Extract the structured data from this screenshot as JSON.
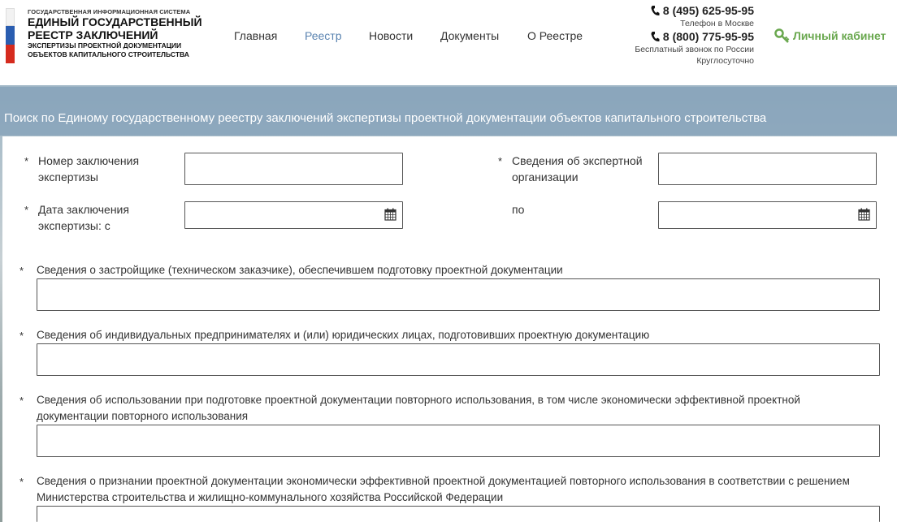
{
  "logo": {
    "top_small": "ГОСУДАРСТВЕННАЯ ИНФОРМАЦИОННАЯ СИСТЕМА",
    "line1": "ЕДИНЫЙ ГОСУДАРСТВЕННЫЙ",
    "line2": "РЕЕСТР ЗАКЛЮЧЕНИЙ",
    "line3": "ЭКСПЕРТИЗЫ ПРОЕКТНОЙ ДОКУМЕНТАЦИИ",
    "line4": "ОБЪЕКТОВ КАПИТАЛЬНОГО СТРОИТЕЛЬСТВА"
  },
  "nav": {
    "items": [
      {
        "label": "Главная"
      },
      {
        "label": "Реестр"
      },
      {
        "label": "Новости"
      },
      {
        "label": "Документы"
      },
      {
        "label": "О Реестре"
      }
    ]
  },
  "contacts": {
    "phone_moscow": "8 (495) 625-95-95",
    "note_moscow": "Телефон в Москве",
    "phone_russia": "8 (800) 775-95-95",
    "note_russia": "Бесплатный звонок по России",
    "note_hours": "Круглосуточно"
  },
  "cabinet_label": "Личный кабинет",
  "page_title": "Поиск по Единому государственному реестру заключений экспертизы проектной документации объектов капитального строительства",
  "form": {
    "required_mark": "*",
    "fields": {
      "conclusion_number": {
        "label": "Номер заключения экспертизы",
        "value": ""
      },
      "expert_org": {
        "label": "Сведения об экспертной организации",
        "value": ""
      },
      "date_from": {
        "label": "Дата заключения экспертизы: с",
        "value": ""
      },
      "date_to": {
        "label": "по",
        "value": ""
      },
      "developer": {
        "label": "Сведения о застройщике (техническом заказчике), обеспечившем подготовку проектной документации",
        "value": ""
      },
      "designers": {
        "label": "Сведения об индивидуальных предпринимателях и (или) юридических лицах, подготовивших проектную документацию",
        "value": ""
      },
      "reuse": {
        "label": "Сведения об использовании при подготовке проектной документации повторного использования, в том числе экономически эффективной проектной документации повторного использования",
        "value": ""
      },
      "recognition": {
        "label": "Сведения о признании проектной документации экономически эффективной проектной документацией повторного использования в соответствии с решением Министерства строительства и жилищно-коммунального хозяйства Российской Федерации",
        "value": ""
      }
    }
  },
  "colors": {
    "nav_active": "#5b84b1",
    "cabinet": "#6aa84f",
    "title_bar": "#82a0b9"
  }
}
